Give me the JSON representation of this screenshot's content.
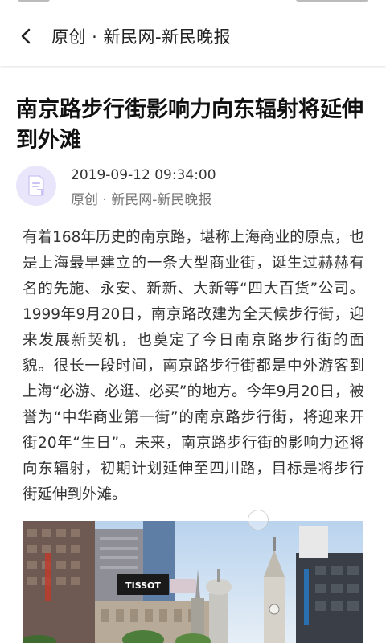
{
  "header": {
    "back_icon": "chevron-left-icon",
    "title": "原创 · 新民网-新民晚报"
  },
  "article": {
    "title": "南京路步行街影响力向东辐射将延伸到外滩",
    "avatar_icon": "document-icon",
    "avatar_color": "#e9e6fb",
    "date": "2019-09-12 09:34:00",
    "source": "原创 · 新民网-新民晚报",
    "body": "有着168年历史的南京路，堪称上海商业的原点，也是上海最早建立的一条大型商业街，诞生过赫赫有名的先施、永安、新新、大新等“四大百货”公司。1999年9月20日，南京路改建为全天候步行街，迎来发展新契机，也奠定了今日南京路步行街的面貌。很长一段时间，南京路步行街都是中外游客到上海“必游、必逛、必买”的地方。今年9月20日，被誉为“中华商业第一街”的南京路步行街，将迎来开街20年“生日”。未来，南京路步行街的影响力还将向东辐射，初期计划延伸至四川路，目标是将步行街延伸到外滩。",
    "photo": {
      "sign_text": "TISSOT"
    }
  }
}
